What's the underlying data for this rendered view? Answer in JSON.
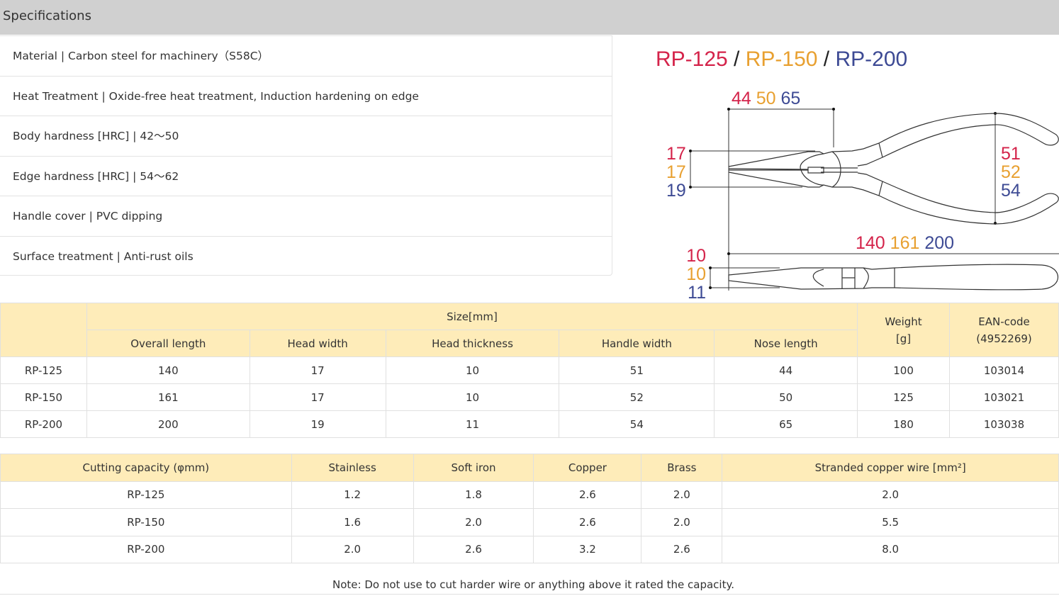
{
  "header": {
    "title": "Specifications"
  },
  "specs": [
    "Material | Carbon steel for machinery（S58C）",
    "Heat Treatment | Oxide-free heat treatment, Induction hardening on edge",
    "Body hardness [HRC] | 42～50",
    "Edge hardness [HRC] | 54～62",
    "Handle cover | PVC dipping",
    "Surface treatment | Anti-rust oils"
  ],
  "colors": {
    "rp125": "#d4234a",
    "rp150": "#e8a030",
    "rp200": "#3d4a94"
  },
  "diagram": {
    "title": {
      "m1": "RP-125",
      "sep1": " / ",
      "m2": "RP-150",
      "sep2": " / ",
      "m3": "RP-200"
    },
    "nose": [
      "44",
      "50",
      "65"
    ],
    "head_width": [
      "17",
      "17",
      "19"
    ],
    "handle_width": [
      "51",
      "52",
      "54"
    ],
    "overall": [
      "140",
      "161",
      "200"
    ],
    "thickness": [
      "10",
      "10",
      "11"
    ]
  },
  "size_table": {
    "group_header": "Size[mm]",
    "weight_header": "Weight\n[g]",
    "weight_l1": "Weight",
    "weight_l2": "[g]",
    "ean_l1": "EAN-code",
    "ean_l2": "(4952269)",
    "columns": [
      "Overall length",
      "Head width",
      "Head thickness",
      "Handle width",
      "Nose length"
    ],
    "rows": [
      [
        "RP-125",
        "140",
        "17",
        "10",
        "51",
        "44",
        "100",
        "103014"
      ],
      [
        "RP-150",
        "161",
        "17",
        "10",
        "52",
        "50",
        "125",
        "103021"
      ],
      [
        "RP-200",
        "200",
        "19",
        "11",
        "54",
        "65",
        "180",
        "103038"
      ]
    ]
  },
  "cut_table": {
    "columns": [
      "Cutting capacity (φmm)",
      "Stainless",
      "Soft iron",
      "Copper",
      "Brass",
      "Stranded copper wire [mm²]"
    ],
    "rows": [
      [
        "RP-125",
        "1.2",
        "1.8",
        "2.6",
        "2.0",
        "2.0"
      ],
      [
        "RP-150",
        "1.6",
        "2.0",
        "2.6",
        "2.0",
        "5.5"
      ],
      [
        "RP-200",
        "2.0",
        "2.6",
        "3.2",
        "2.6",
        "8.0"
      ]
    ]
  },
  "note": "Note: Do not use to cut harder wire or anything above it rated the capacity."
}
